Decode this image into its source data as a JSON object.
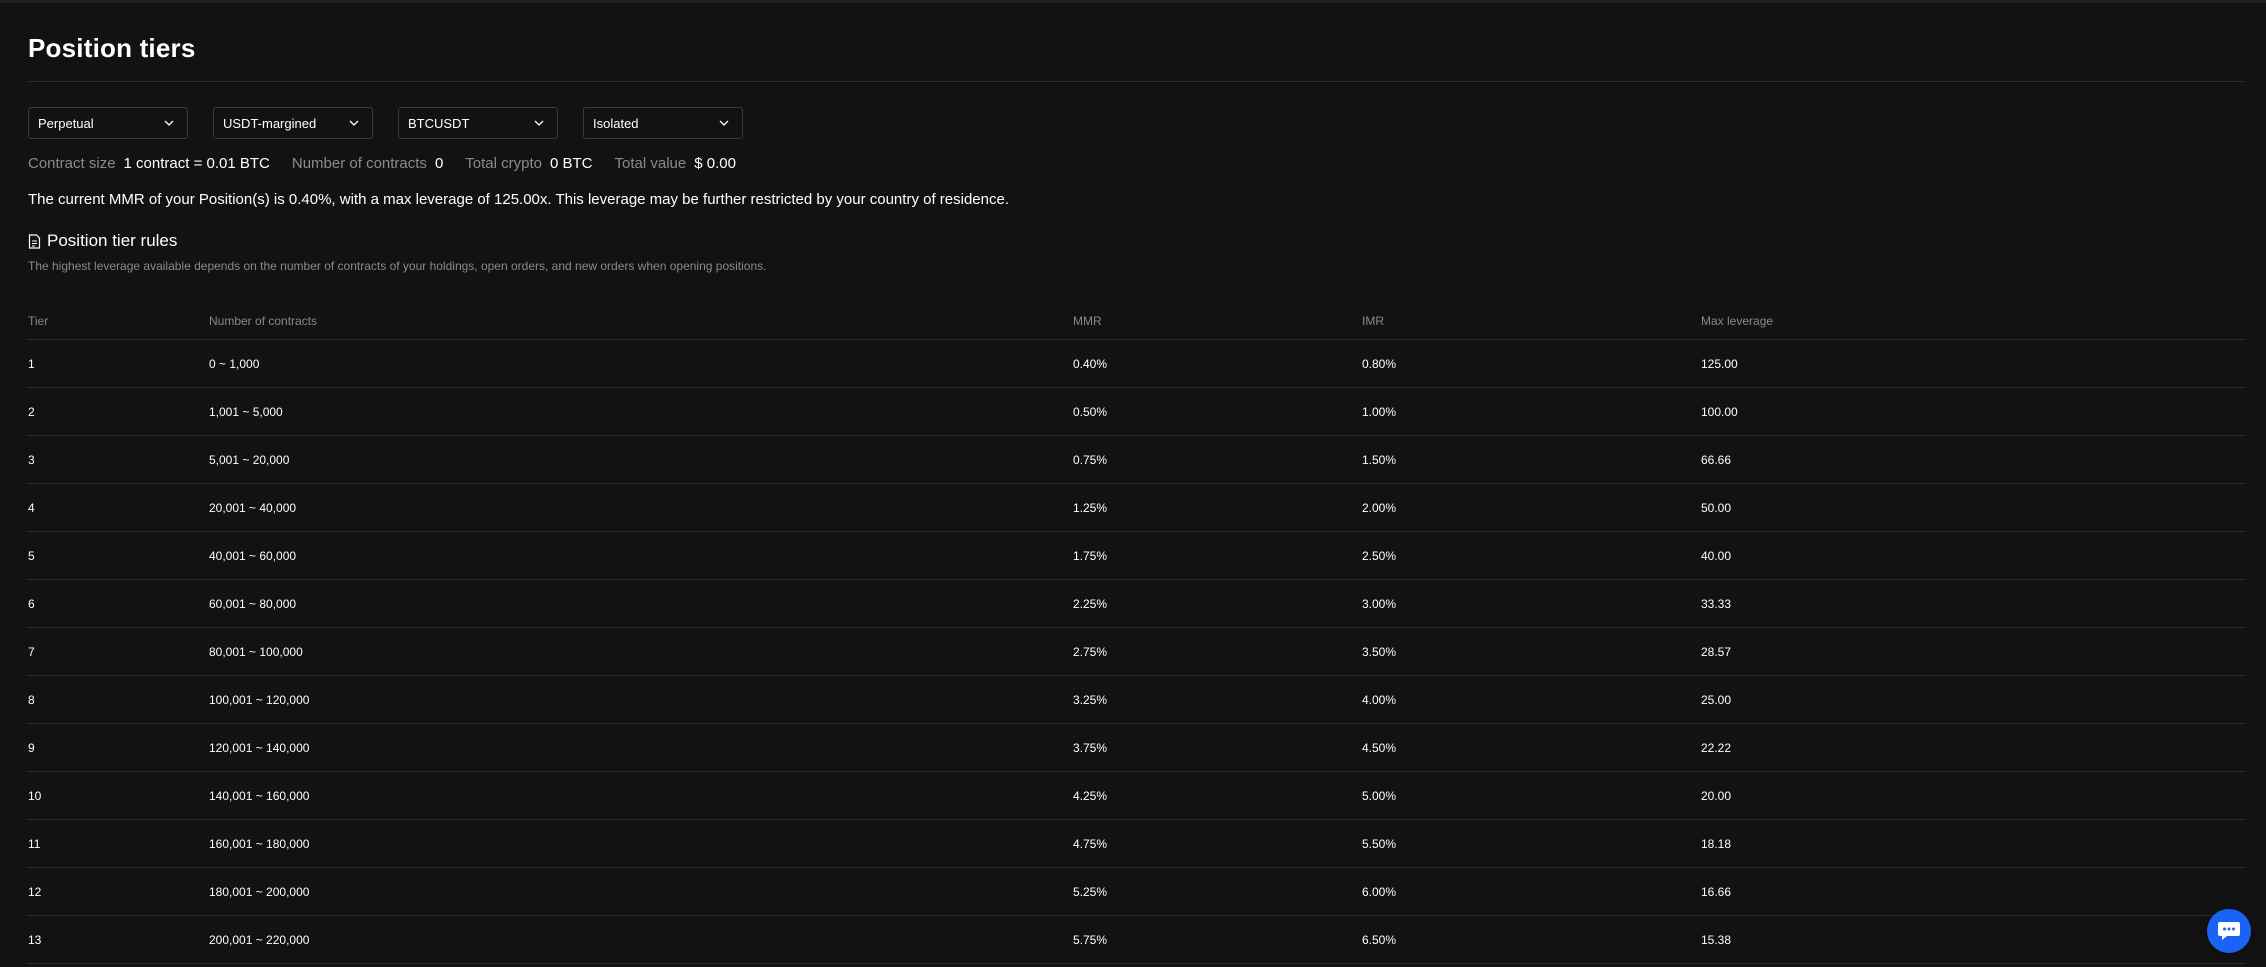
{
  "page": {
    "title": "Position tiers"
  },
  "filters": [
    {
      "value": "Perpetual"
    },
    {
      "value": "USDT-margined"
    },
    {
      "value": "BTCUSDT"
    },
    {
      "value": "Isolated"
    }
  ],
  "contract_info": {
    "contract_size_label": "Contract size",
    "contract_size_value": "1 contract = 0.01 BTC",
    "num_contracts_label": "Number of contracts",
    "num_contracts_value": "0",
    "total_crypto_label": "Total crypto",
    "total_crypto_value": "0 BTC",
    "total_value_label": "Total value",
    "total_value_value": "$ 0.00"
  },
  "notice": {
    "mmr_text": "The current MMR of your Position(s) is 0.40%, with a max leverage of 125.00x. This leverage may be further restricted by your country of residence."
  },
  "rules": {
    "heading": "Position tier rules",
    "subtext": "The highest leverage available depends on the number of contracts of your holdings, open orders, and new orders when opening positions."
  },
  "table": {
    "headers": {
      "tier": "Tier",
      "contracts": "Number of contracts",
      "mmr": "MMR",
      "imr": "IMR",
      "max_leverage": "Max leverage"
    },
    "rows": [
      {
        "tier": "1",
        "contracts": "0 ~ 1,000",
        "mmr": "0.40%",
        "imr": "0.80%",
        "max_leverage": "125.00"
      },
      {
        "tier": "2",
        "contracts": "1,001 ~ 5,000",
        "mmr": "0.50%",
        "imr": "1.00%",
        "max_leverage": "100.00"
      },
      {
        "tier": "3",
        "contracts": "5,001 ~ 20,000",
        "mmr": "0.75%",
        "imr": "1.50%",
        "max_leverage": "66.66"
      },
      {
        "tier": "4",
        "contracts": "20,001 ~ 40,000",
        "mmr": "1.25%",
        "imr": "2.00%",
        "max_leverage": "50.00"
      },
      {
        "tier": "5",
        "contracts": "40,001 ~ 60,000",
        "mmr": "1.75%",
        "imr": "2.50%",
        "max_leverage": "40.00"
      },
      {
        "tier": "6",
        "contracts": "60,001 ~ 80,000",
        "mmr": "2.25%",
        "imr": "3.00%",
        "max_leverage": "33.33"
      },
      {
        "tier": "7",
        "contracts": "80,001 ~ 100,000",
        "mmr": "2.75%",
        "imr": "3.50%",
        "max_leverage": "28.57"
      },
      {
        "tier": "8",
        "contracts": "100,001 ~ 120,000",
        "mmr": "3.25%",
        "imr": "4.00%",
        "max_leverage": "25.00"
      },
      {
        "tier": "9",
        "contracts": "120,001 ~ 140,000",
        "mmr": "3.75%",
        "imr": "4.50%",
        "max_leverage": "22.22"
      },
      {
        "tier": "10",
        "contracts": "140,001 ~ 160,000",
        "mmr": "4.25%",
        "imr": "5.00%",
        "max_leverage": "20.00"
      },
      {
        "tier": "11",
        "contracts": "160,001 ~ 180,000",
        "mmr": "4.75%",
        "imr": "5.50%",
        "max_leverage": "18.18"
      },
      {
        "tier": "12",
        "contracts": "180,001 ~ 200,000",
        "mmr": "5.25%",
        "imr": "6.00%",
        "max_leverage": "16.66"
      },
      {
        "tier": "13",
        "contracts": "200,001 ~ 220,000",
        "mmr": "5.75%",
        "imr": "6.50%",
        "max_leverage": "15.38"
      }
    ]
  },
  "chat": {
    "icon": "chat-icon",
    "color": "#1a63f5"
  }
}
